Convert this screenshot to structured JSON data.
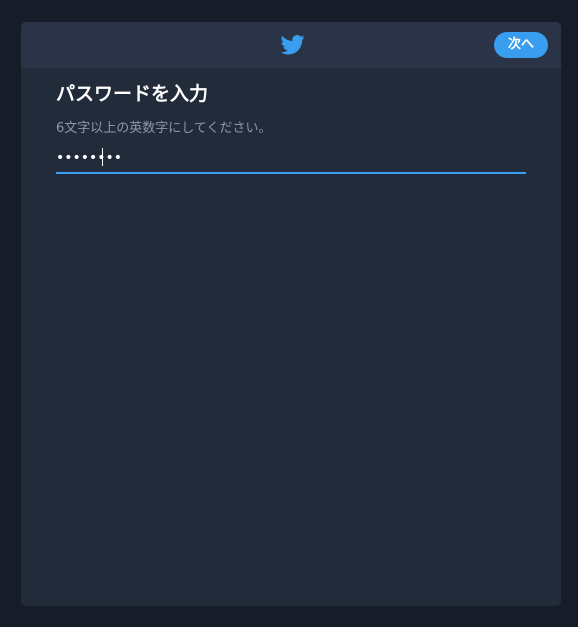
{
  "header": {
    "logo_icon": "bird-icon",
    "next_label": "次へ",
    "accent_color": "#3a9ef0"
  },
  "main": {
    "title": "パスワードを入力",
    "hint": "6文字以上の英数字にしてください。",
    "password": {
      "value": "secret12"
    }
  }
}
